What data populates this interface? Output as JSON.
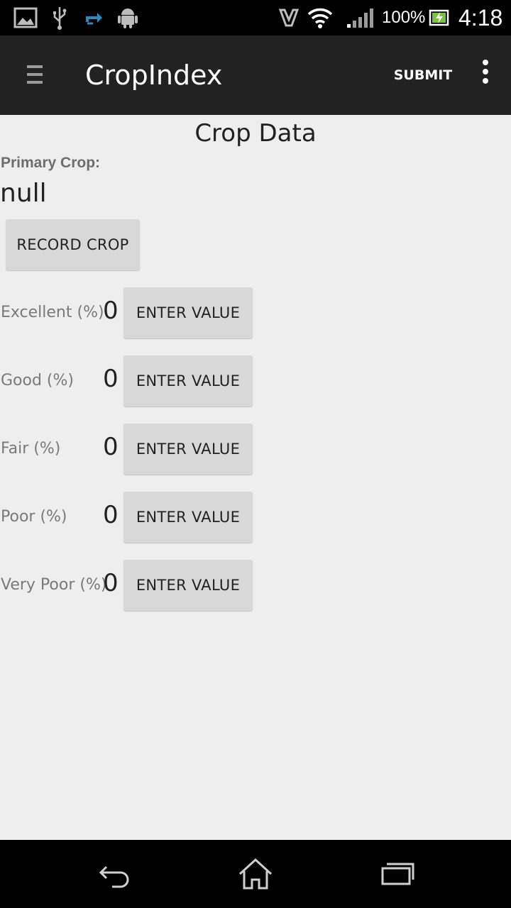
{
  "status_bar": {
    "icons": [
      "gallery-icon",
      "usb-icon",
      "data-sync-icon",
      "android-debug-icon",
      "nfc-icon",
      "wifi-icon",
      "signal-icon",
      "battery-icon"
    ],
    "battery_percent": "100%",
    "time": "4:18"
  },
  "action_bar": {
    "title": "CropIndex",
    "submit_label": "SUBMIT",
    "menu_icon": "hamburger-icon",
    "overflow_icon": "more-vertical-icon"
  },
  "content": {
    "section_title": "Crop Data",
    "primary_crop_label": "Primary Crop:",
    "primary_crop_value": "null",
    "record_crop_label": "RECORD CROP",
    "rows": [
      {
        "label": "Excellent (%)",
        "value": "0",
        "button": "ENTER VALUE"
      },
      {
        "label": "Good (%)",
        "value": "0",
        "button": "ENTER VALUE"
      },
      {
        "label": "Fair (%)",
        "value": "0",
        "button": "ENTER VALUE"
      },
      {
        "label": "Poor (%)",
        "value": "0",
        "button": "ENTER VALUE"
      },
      {
        "label": "Very Poor (%)",
        "value": "0",
        "button": "ENTER VALUE"
      }
    ]
  },
  "nav_bar": {
    "buttons": [
      "back-icon",
      "home-icon",
      "recent-apps-icon"
    ]
  },
  "colors": {
    "action_bar_bg": "#222222",
    "content_bg": "#eeeeee",
    "button_bg": "#d8d8d8",
    "label_text": "#7a7a7a"
  }
}
